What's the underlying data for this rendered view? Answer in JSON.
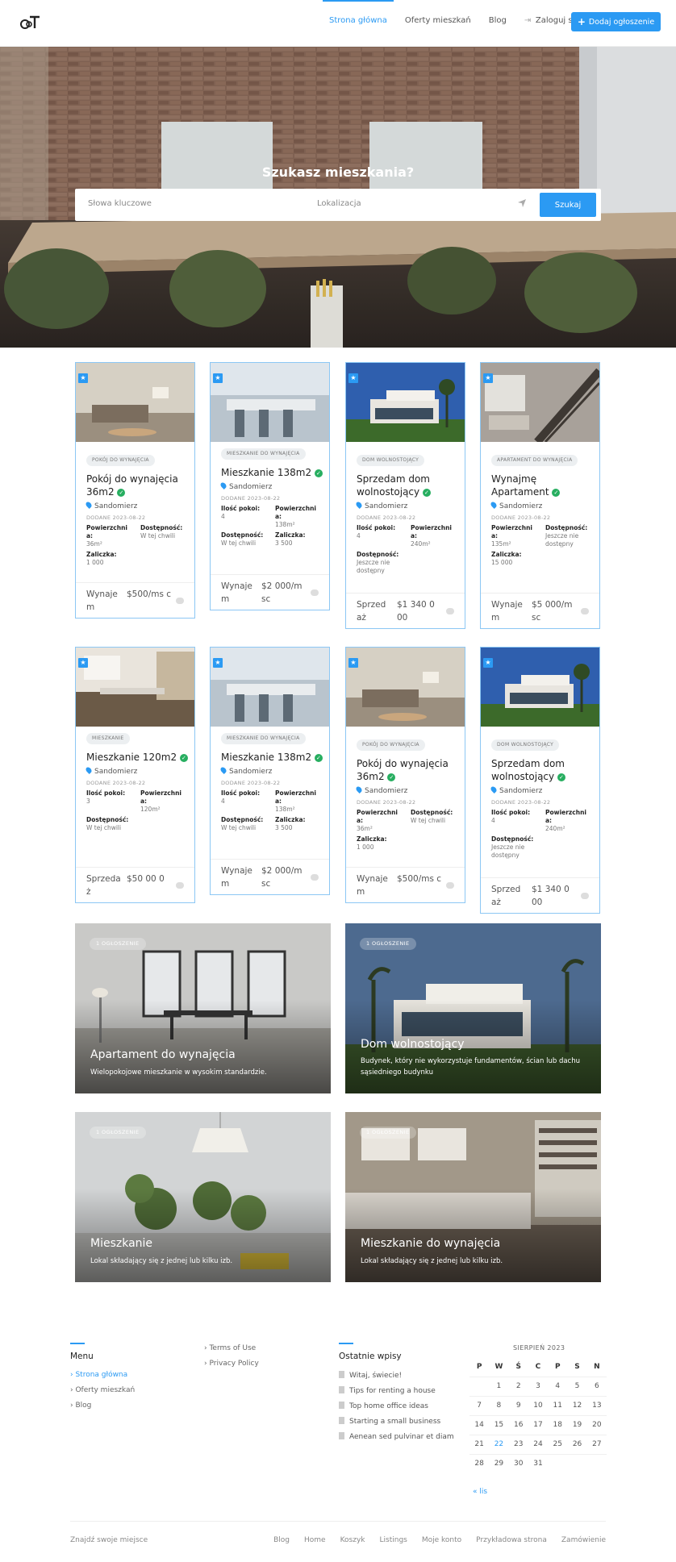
{
  "header": {
    "nav": [
      {
        "label": "Strona główna",
        "active": true
      },
      {
        "label": "Oferty mieszkań",
        "active": false
      },
      {
        "label": "Blog",
        "active": false
      },
      {
        "label": "Zaloguj się",
        "active": false
      }
    ],
    "add_button": "Dodaj ogłoszenie"
  },
  "hero": {
    "title": "Szukasz mieszkania?",
    "keywords_placeholder": "Słowa kluczowe",
    "location_placeholder": "Lokalizacja",
    "search_button": "Szukaj"
  },
  "listings": [
    {
      "badge": "POKÓJ DO WYNAJĘCIA",
      "title": "Pokój do wynajęcia 36m2",
      "city": "Sandomierz",
      "date": "DODANE 2023-08-22",
      "props": [
        [
          "Powierzchni a:",
          "36m²"
        ],
        [
          "Dostępność:",
          "W tej chwili"
        ],
        [
          "Zaliczka:",
          "1 000"
        ]
      ],
      "type": "Wynaje m",
      "price": "$500/ms c"
    },
    {
      "badge": "MIESZKANIE DO WYNAJĘCIA",
      "title": "Mieszkanie 138m2",
      "city": "Sandomierz",
      "date": "DODANE 2023-08-22",
      "props": [
        [
          "Ilość pokoi:",
          "4"
        ],
        [
          "Powierzchni a:",
          "138m²"
        ],
        [
          "Dostępność:",
          "W tej chwili"
        ],
        [
          "Zaliczka:",
          "3 500"
        ]
      ],
      "type": "Wynaje m",
      "price": "$2 000/m sc"
    },
    {
      "badge": "DOM WOLNOSTOJĄCY",
      "title": "Sprzedam dom wolnostojący",
      "city": "Sandomierz",
      "date": "DODANE 2023-08-22",
      "props": [
        [
          "Ilość pokoi:",
          "4"
        ],
        [
          "Powierzchni a:",
          "240m²"
        ],
        [
          "Dostępność:",
          "Jeszcze nie dostępny"
        ]
      ],
      "type": "Sprzed aż",
      "price": "$1 340 0 00"
    },
    {
      "badge": "APARTAMENT DO WYNAJĘCIA",
      "title": "Wynajmę Apartament",
      "city": "Sandomierz",
      "date": "DODANE 2023-08-22",
      "props": [
        [
          "Powierzchni a:",
          "135m²"
        ],
        [
          "Dostępność:",
          "Jeszcze nie dostępny"
        ],
        [
          "Zaliczka:",
          "15 000"
        ]
      ],
      "type": "Wynaje m",
      "price": "$5 000/m sc"
    },
    {
      "badge": "MIESZKANIE",
      "title": "Mieszkanie 120m2",
      "city": "Sandomierz",
      "date": "DODANE 2023-08-22",
      "props": [
        [
          "Ilość pokoi:",
          "3"
        ],
        [
          "Powierzchni a:",
          "120m²"
        ],
        [
          "Dostępność:",
          "W tej chwili"
        ]
      ],
      "type": "Sprzeda ż",
      "price": "$50 00 0"
    },
    {
      "badge": "MIESZKANIE DO WYNAJĘCIA",
      "title": "Mieszkanie 138m2",
      "city": "Sandomierz",
      "date": "DODANE 2023-08-22",
      "props": [
        [
          "Ilość pokoi:",
          "4"
        ],
        [
          "Powierzchni a:",
          "138m²"
        ],
        [
          "Dostępność:",
          "W tej chwili"
        ],
        [
          "Zaliczka:",
          "3 500"
        ]
      ],
      "type": "Wynaje m",
      "price": "$2 000/m sc"
    },
    {
      "badge": "POKÓJ DO WYNAJĘCIA",
      "title": "Pokój do wynajęcia 36m2",
      "city": "Sandomierz",
      "date": "DODANE 2023-08-22",
      "props": [
        [
          "Powierzchni a:",
          "36m²"
        ],
        [
          "Dostępność:",
          "W tej chwili"
        ],
        [
          "Zaliczka:",
          "1 000"
        ]
      ],
      "type": "Wynaje m",
      "price": "$500/ms c"
    },
    {
      "badge": "DOM WOLNOSTOJĄCY",
      "title": "Sprzedam dom wolnostojący",
      "city": "Sandomierz",
      "date": "DODANE 2023-08-22",
      "props": [
        [
          "Ilość pokoi:",
          "4"
        ],
        [
          "Powierzchni a:",
          "240m²"
        ],
        [
          "Dostępność:",
          "Jeszcze nie dostępny"
        ]
      ],
      "type": "Sprzed aż",
      "price": "$1 340 0 00"
    }
  ],
  "categories": [
    {
      "count": "1 OGŁOSZENIE",
      "title": "Apartament do wynajęcia",
      "desc": "Wielopokojowe mieszkanie w wysokim standardzie."
    },
    {
      "count": "1 OGŁOSZENIE",
      "title": "Dom wolnostojący",
      "desc": "Budynek, który nie wykorzystuje fundamentów, ścian lub dachu sąsiedniego budynku"
    },
    {
      "count": "1 OGŁOSZENIE",
      "title": "Mieszkanie",
      "desc": "Lokal składający się z jednej lub kilku izb."
    },
    {
      "count": "1 OGŁOSZENIE",
      "title": "Mieszkanie do wynajęcia",
      "desc": "Lokal składający się z jednej lub kilku izb."
    }
  ],
  "footer": {
    "menu_title": "Menu",
    "menu": [
      {
        "label": "Strona główna",
        "active": true
      },
      {
        "label": "Oferty mieszkań",
        "active": false
      },
      {
        "label": "Blog",
        "active": false
      }
    ],
    "legal": [
      "Terms of Use",
      "Privacy Policy"
    ],
    "posts_title": "Ostatnie wpisy",
    "posts": [
      "Witaj, świecie!",
      "Tips for renting a house",
      "Top home office ideas",
      "Starting a small business",
      "Aenean sed pulvinar et diam"
    ],
    "calendar": {
      "title": "SIERPIEŃ 2023",
      "days": [
        "P",
        "W",
        "Ś",
        "C",
        "P",
        "S",
        "N"
      ],
      "weeks": [
        [
          "",
          "1",
          "2",
          "3",
          "4",
          "5",
          "6"
        ],
        [
          "7",
          "8",
          "9",
          "10",
          "11",
          "12",
          "13"
        ],
        [
          "14",
          "15",
          "16",
          "17",
          "18",
          "19",
          "20"
        ],
        [
          "21",
          "22",
          "23",
          "24",
          "25",
          "26",
          "27"
        ],
        [
          "28",
          "29",
          "30",
          "31",
          "",
          "",
          ""
        ]
      ],
      "today": "22",
      "prev": "« lis"
    },
    "brand": "Znajdź swoje miejsce",
    "bottom_links": [
      "Blog",
      "Home",
      "Koszyk",
      "Listings",
      "Moje konto",
      "Przykładowa strona",
      "Zamówienie"
    ]
  }
}
